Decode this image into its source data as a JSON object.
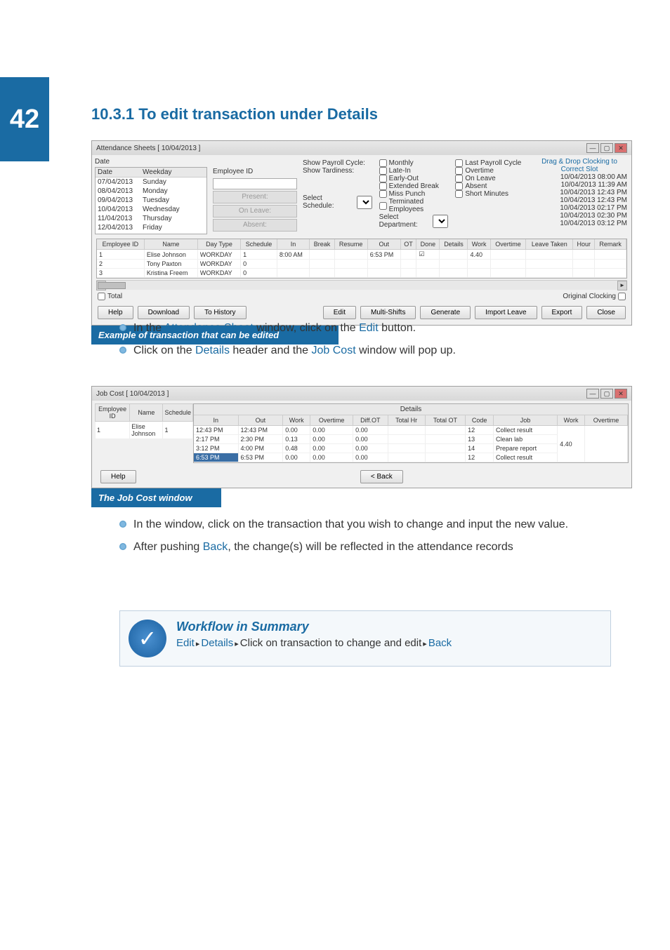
{
  "page_number": "42",
  "heading": "10.3.1 To edit transaction under Details",
  "bullets1": [
    {
      "pre": "In the ",
      "link1": "Attendance Sheet",
      "mid": " window, click on the ",
      "link2": "Edit",
      "post": " button."
    },
    {
      "pre": "Click on the ",
      "link1": "Details",
      "mid": " header and the ",
      "link2": "Job Cost",
      "post": " window will pop up."
    }
  ],
  "bullets2": [
    {
      "text": "In the window, click on the transaction that you wish to change and input the new value."
    },
    {
      "pre": "After pushing ",
      "link1": "Back",
      "post": ", the change(s) will be reflected in the attendance records"
    }
  ],
  "win1": {
    "title": "Attendance Sheets   [ 10/04/2013 ]",
    "date_header": "Date",
    "weekday_header": "Weekday",
    "dates": [
      {
        "d": "07/04/2013",
        "w": "Sunday"
      },
      {
        "d": "08/04/2013",
        "w": "Monday"
      },
      {
        "d": "09/04/2013",
        "w": "Tuesday"
      },
      {
        "d": "10/04/2013",
        "w": "Wednesday"
      },
      {
        "d": "11/04/2013",
        "w": "Thursday"
      },
      {
        "d": "12/04/2013",
        "w": "Friday"
      }
    ],
    "emp_id_label": "Employee ID",
    "disabled_btns": [
      "Present:",
      "On Leave:",
      "Absent:"
    ],
    "checks_col1": [
      "Show Payroll Cycle:",
      "Show Tardiness:"
    ],
    "checks_col2": [
      "Monthly",
      "Late-In",
      "Early-Out",
      "Extended Break",
      "Miss Punch",
      "Terminated Employees"
    ],
    "checks_col3": [
      "Last Payroll Cycle",
      "Overtime",
      "On Leave",
      "Absent",
      "Short Minutes"
    ],
    "drag_label": "Drag & Drop Clocking to Correct Slot",
    "timestamps": [
      "10/04/2013 08:00 AM",
      "10/04/2013 11:39 AM",
      "10/04/2013 12:43 PM",
      "10/04/2013 12:43 PM",
      "10/04/2013 02:17 PM",
      "10/04/2013 02:30 PM",
      "10/04/2013 03:12 PM"
    ],
    "sel_schedule_label": "Select Schedule:",
    "sel_dept_label": "Select Department:",
    "grid_headers": [
      "Employee ID",
      "Name",
      "Day Type",
      "Schedule",
      "In",
      "Break",
      "Resume",
      "Out",
      "OT",
      "Done",
      "Details",
      "Work",
      "Overtime",
      "Leave Taken",
      "Hour",
      "Remark"
    ],
    "grid_rows": [
      {
        "id": "1",
        "name": "Elise Johnson",
        "dt": "WORKDAY",
        "sch": "1",
        "in": "8:00 AM",
        "out": "6:53 PM",
        "done": "☑",
        "work": "4.40"
      },
      {
        "id": "2",
        "name": "Tony Paxton",
        "dt": "WORKDAY",
        "sch": "0"
      },
      {
        "id": "3",
        "name": "Kristina Freem",
        "dt": "WORKDAY",
        "sch": "0"
      }
    ],
    "total_label": "Total",
    "original_label": "Original Clocking",
    "buttons": [
      "Help",
      "Download",
      "To History",
      "Edit",
      "Multi-Shifts",
      "Generate",
      "Import Leave",
      "Export",
      "Close"
    ],
    "caption": "Example of transaction that can be edited"
  },
  "win2": {
    "title": "Job Cost   [ 10/04/2013 ]",
    "left_headers": [
      "Employee ID",
      "Name",
      "Schedule"
    ],
    "left_row": {
      "id": "1",
      "name": "Elise Johnson",
      "sch": "1"
    },
    "details_label": "Details",
    "right_headers": [
      "In",
      "Out",
      "Work",
      "Overtime",
      "Diff.OT",
      "Total Hr",
      "Total OT",
      "Code",
      "Job"
    ],
    "right_summary": [
      "Work",
      "Overtime"
    ],
    "right_summary_val": "4.40",
    "rows": [
      {
        "in": "12:43 PM",
        "out": "12:43 PM",
        "w": "0.00",
        "ot": "0.00",
        "d": "0.00",
        "code": "12",
        "job": "Collect result"
      },
      {
        "in": "2:17 PM",
        "out": "2:30 PM",
        "w": "0.13",
        "ot": "0.00",
        "d": "0.00",
        "code": "13",
        "job": "Clean lab"
      },
      {
        "in": "3:12 PM",
        "out": "4:00 PM",
        "w": "0.48",
        "ot": "0.00",
        "d": "0.00",
        "code": "14",
        "job": "Prepare report"
      },
      {
        "in": "6:53 PM",
        "out": "6:53 PM",
        "w": "0.00",
        "ot": "0.00",
        "d": "0.00",
        "code": "12",
        "job": "Collect result",
        "sel": true
      }
    ],
    "back_btn": "< Back",
    "help_btn": "Help",
    "caption": "The Job Cost window"
  },
  "workflow": {
    "title": "Workflow in Summary",
    "s1": "Edit",
    "s2": "Details",
    "s3": "Click on transaction to change and edit",
    "s4": "Back"
  }
}
